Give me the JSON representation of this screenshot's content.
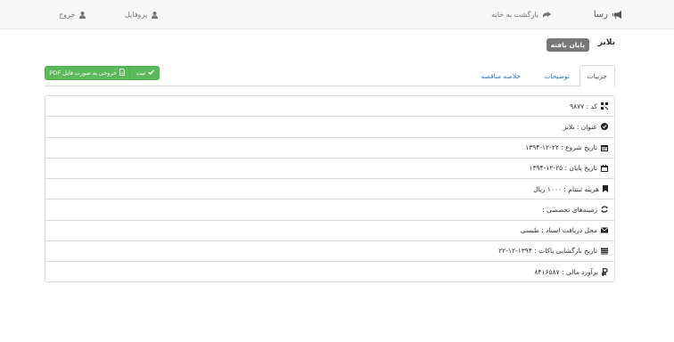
{
  "navbar": {
    "brand": "رسا",
    "home": "بازگشت به خانه",
    "profile": "پروفایل",
    "logout": "خروج"
  },
  "header": {
    "title": "بلابز",
    "status": "پایان یافته"
  },
  "tabs": [
    "جزییات",
    "توضیحات",
    "خلاصه مناقصه"
  ],
  "actions": {
    "submit": "ثبت",
    "export_pdf": "خروجی به صورت فایل PDF"
  },
  "details": [
    {
      "icon": "barcode-icon",
      "text": "کد : ۹۸۷۷"
    },
    {
      "icon": "check-circle-icon",
      "text": "عنوان : بلابز"
    },
    {
      "icon": "calendar-icon",
      "text": "تاریخ شروع : ۲۲-۱۲-۱۳۹۴"
    },
    {
      "icon": "calendar-empty-icon",
      "text": "تاریخ پایان : ۲۵-۱۲-۱۳۹۴"
    },
    {
      "icon": "bookmark-icon",
      "text": "هزینه ثبتنام : ۱۰۰۰ ریال"
    },
    {
      "icon": "refresh-icon",
      "text": "زمینه‌های تخصصی :"
    },
    {
      "icon": "envelope-icon",
      "text": "محل دریافت اسناد : طبسی"
    },
    {
      "icon": "list-icon",
      "text": "تاریخ بازگشایی پاکات : ۱۳۹۴-۱۲-۲۲"
    },
    {
      "icon": "rial-icon",
      "text": "برآورد مالی : ۸۴۱۶۵۸۷"
    }
  ],
  "colors": {
    "navbar_bg": "#f8f8f8",
    "link": "#337ab7",
    "success": "#5cb85c",
    "badge": "#777777",
    "border": "#dddddd"
  }
}
